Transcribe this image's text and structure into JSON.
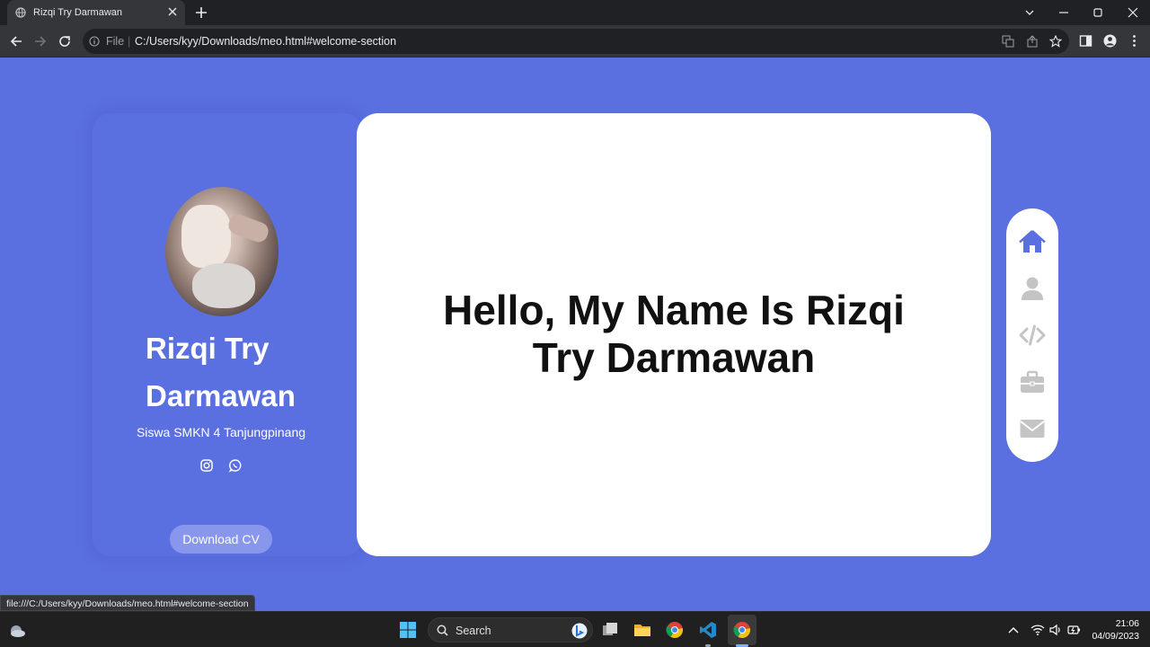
{
  "browser": {
    "tab_title": "Rizqi Try Darmawan",
    "file_label": "File",
    "url": "C:/Users/kyy/Downloads/meo.html#welcome-section",
    "status_url": "file:///C:/Users/kyy/Downloads/meo.html#welcome-section"
  },
  "profile": {
    "name": "Rizqi Try Darmawan",
    "subtitle": "Siswa SMKN 4 Tanjungpinang",
    "download_label": "Download CV",
    "social_icons": [
      "instagram-icon",
      "whatsapp-icon"
    ]
  },
  "welcome": {
    "heading": "Hello, My Name Is Rizqi Try Darmawan"
  },
  "nav": {
    "items": [
      "home",
      "about",
      "skills",
      "portfolio",
      "contact"
    ],
    "active": "home"
  },
  "taskbar": {
    "search_label": "Search",
    "time": "21:06",
    "date": "04/09/2023"
  },
  "colors": {
    "page_bg": "#5a6fe0",
    "accent": "#5a6fe0",
    "nav_inactive": "#c4c4c4",
    "button_bg": "#8896ec"
  }
}
